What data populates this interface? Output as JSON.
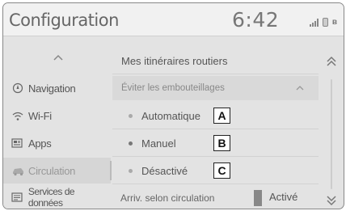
{
  "header": {
    "title": "Configuration",
    "clock": "6:42",
    "bluetooth_glyph": "ʙ"
  },
  "sidebar": {
    "items": [
      {
        "label": "Navigation",
        "icon": "compass-icon"
      },
      {
        "label": "Wi-Fi",
        "icon": "wifi-icon"
      },
      {
        "label": "Apps",
        "icon": "apps-icon"
      },
      {
        "label": "Circulation",
        "icon": "car-icon",
        "active": true
      },
      {
        "label": "Services de données",
        "icon": "data-services-icon"
      }
    ]
  },
  "main": {
    "heading": "Mes itinéraires routiers",
    "subheading": "Éviter les embouteillages",
    "options": [
      {
        "label": "Automatique",
        "badge": "A"
      },
      {
        "label": "Manuel",
        "badge": "B"
      },
      {
        "label": "Désactivé",
        "badge": "C"
      }
    ],
    "traffic": {
      "label": "Arriv. selon circulation",
      "state": "Activé"
    }
  },
  "colors": {
    "background": "#e3e3e3",
    "header": "#f1f1f1",
    "text": "#555555",
    "badge_border": "#222222"
  }
}
